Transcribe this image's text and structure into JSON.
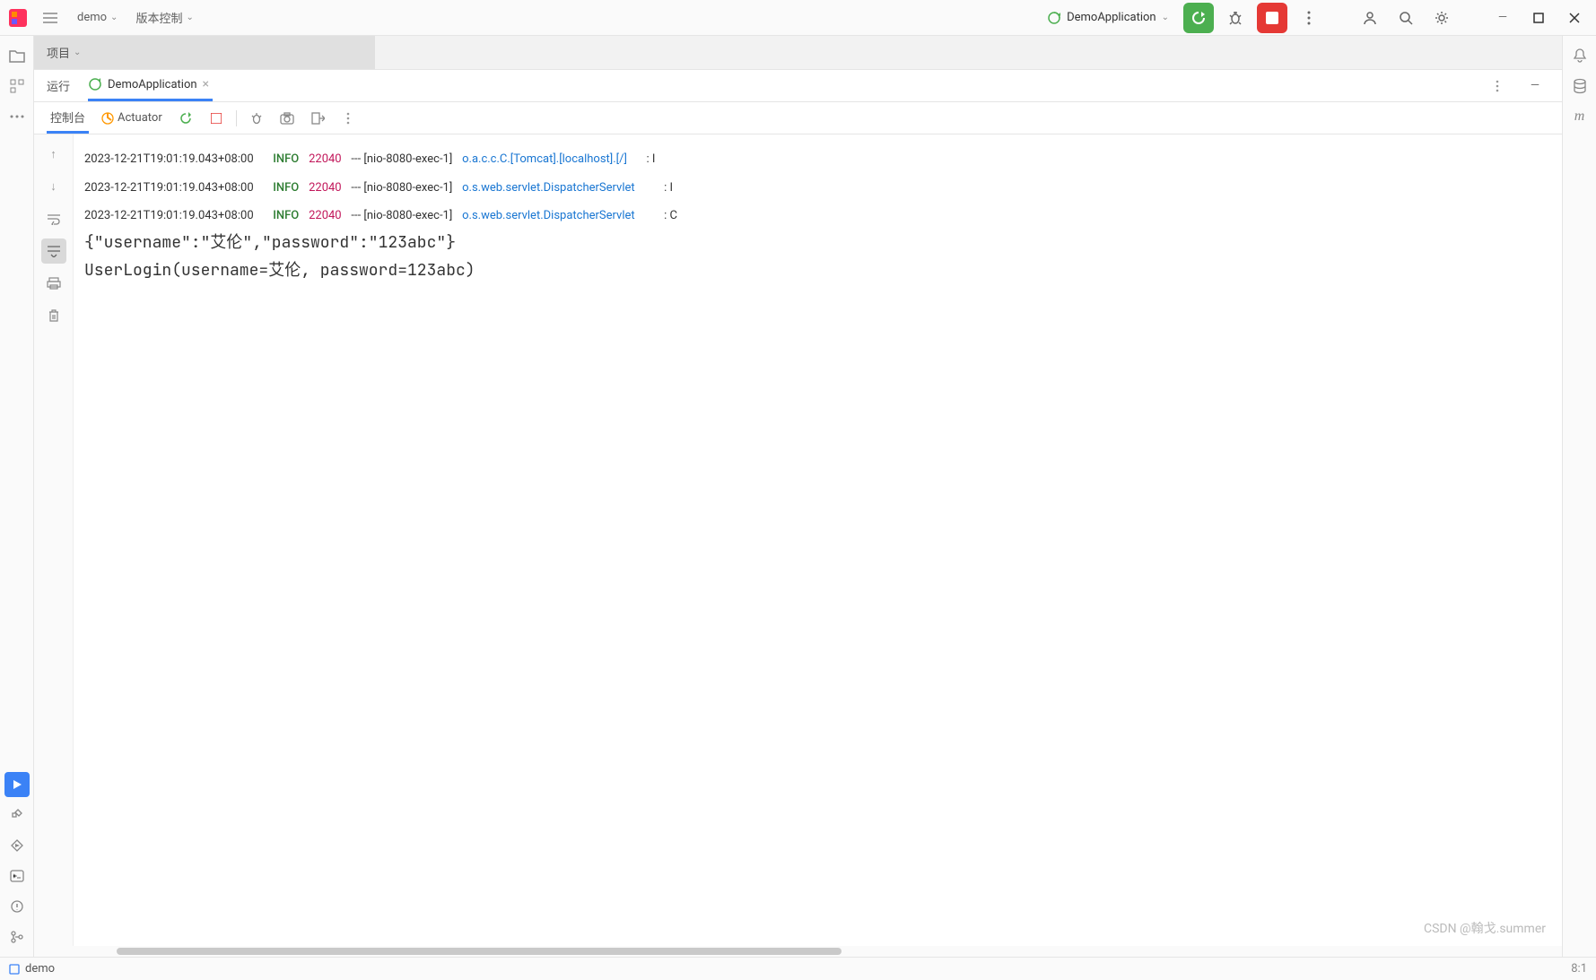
{
  "titlebar": {
    "project": "demo",
    "vcs": "版本控制",
    "run_config": "DemoApplication"
  },
  "project_bar": {
    "label": "项目"
  },
  "run_panel": {
    "tab_run": "运行",
    "tab_app": "DemoApplication"
  },
  "console_toolbar": {
    "tab_console": "控制台",
    "actuator": "Actuator"
  },
  "log": {
    "lines": [
      {
        "ts": "2023-12-21T19:01:19.043+08:00",
        "level": "INFO",
        "pid": "22040",
        "sep": "---",
        "thread": "[nio-8080-exec-1]",
        "logger": "o.a.c.c.C.[Tomcat].[localhost].[/]",
        "colon": ":",
        "tail": "I"
      },
      {
        "ts": "2023-12-21T19:01:19.043+08:00",
        "level": "INFO",
        "pid": "22040",
        "sep": "---",
        "thread": "[nio-8080-exec-1]",
        "logger": "o.s.web.servlet.DispatcherServlet",
        "colon": ":",
        "tail": "I"
      },
      {
        "ts": "2023-12-21T19:01:19.043+08:00",
        "level": "INFO",
        "pid": "22040",
        "sep": "---",
        "thread": "[nio-8080-exec-1]",
        "logger": "o.s.web.servlet.DispatcherServlet",
        "colon": ":",
        "tail": "C"
      }
    ],
    "plain": [
      "{\"username\":\"艾伦\",\"password\":\"123abc\"}",
      "UserLogin(username=艾伦, password=123abc)"
    ]
  },
  "status": {
    "module": "demo",
    "position": "8:1"
  },
  "watermark": "CSDN @翰戈.summer"
}
